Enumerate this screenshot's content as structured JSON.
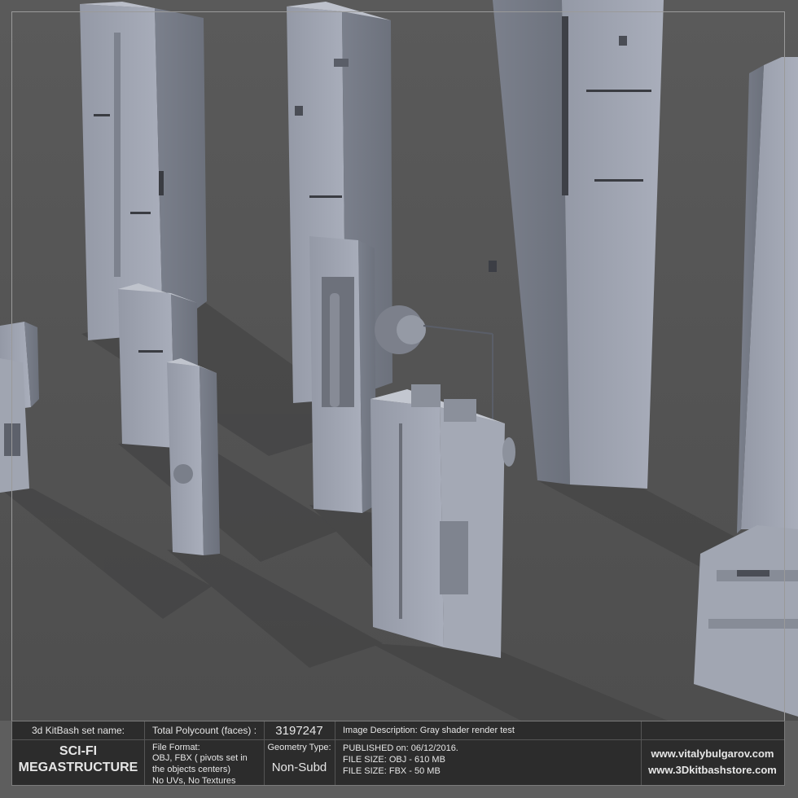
{
  "panel": {
    "set_name_label": "3d KitBash set name:",
    "set_name_line1": "SCI-FI",
    "set_name_line2": "MEGASTRUCTURE",
    "polycount_label": "Total Polycount (faces) :",
    "polycount_value": "3197247",
    "file_format_label": "File Format:",
    "file_format_line1": "OBJ, FBX ( pivots set in",
    "file_format_line2": "the objects centers)",
    "file_format_line3": "No UVs, No Textures",
    "geometry_type_label": "Geometry Type:",
    "geometry_type_value": "Non-Subd",
    "image_description": "Image Description: Gray shader render test",
    "published": "PUBLISHED on: 06/12/2016.",
    "file_size_obj": "FILE SIZE: OBJ - 610 MB",
    "file_size_fbx": "FILE SIZE: FBX - 50 MB",
    "website_1": "www.vitalybulgarov.com",
    "website_2": "www.3Dkitbashstore.com"
  },
  "colors": {
    "background": "#5e5e5e",
    "panel_bg": "#2c2c2c",
    "panel_text": "#e6e6e6",
    "structure_light": "#a9aebb",
    "structure_shadow": "#6c717c"
  }
}
